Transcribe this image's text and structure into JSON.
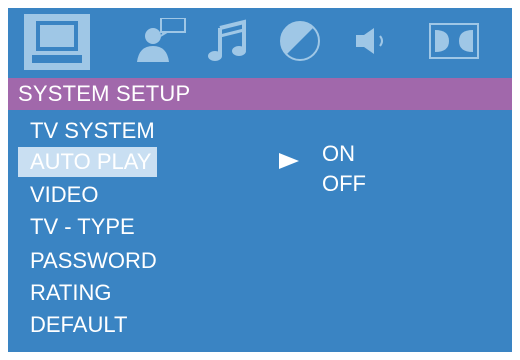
{
  "icons": [
    {
      "name": "monitor-icon",
      "selected": true
    },
    {
      "name": "user-icon",
      "selected": false
    },
    {
      "name": "music-note-icon",
      "selected": false
    },
    {
      "name": "contrast-icon",
      "selected": false
    },
    {
      "name": "speaker-icon",
      "selected": false
    },
    {
      "name": "dolby-icon",
      "selected": false
    }
  ],
  "header": {
    "title": "SYSTEM SETUP"
  },
  "menu": {
    "items": [
      {
        "label": "TV SYSTEM",
        "selected": false
      },
      {
        "label": "AUTO PLAY",
        "selected": true
      },
      {
        "label": "VIDEO",
        "selected": false
      },
      {
        "label": "TV - TYPE",
        "selected": false
      },
      {
        "label": "PASSWORD",
        "selected": false
      },
      {
        "label": "RATING",
        "selected": false
      },
      {
        "label": "DEFAULT",
        "selected": false
      }
    ]
  },
  "options": {
    "items": [
      {
        "label": "ON",
        "pointer": true
      },
      {
        "label": "OFF",
        "pointer": false
      }
    ]
  },
  "colors": {
    "background": "#3a84c3",
    "header": "#a168ab",
    "selection": "#c9dff2",
    "icon": "#9fc7e6"
  }
}
